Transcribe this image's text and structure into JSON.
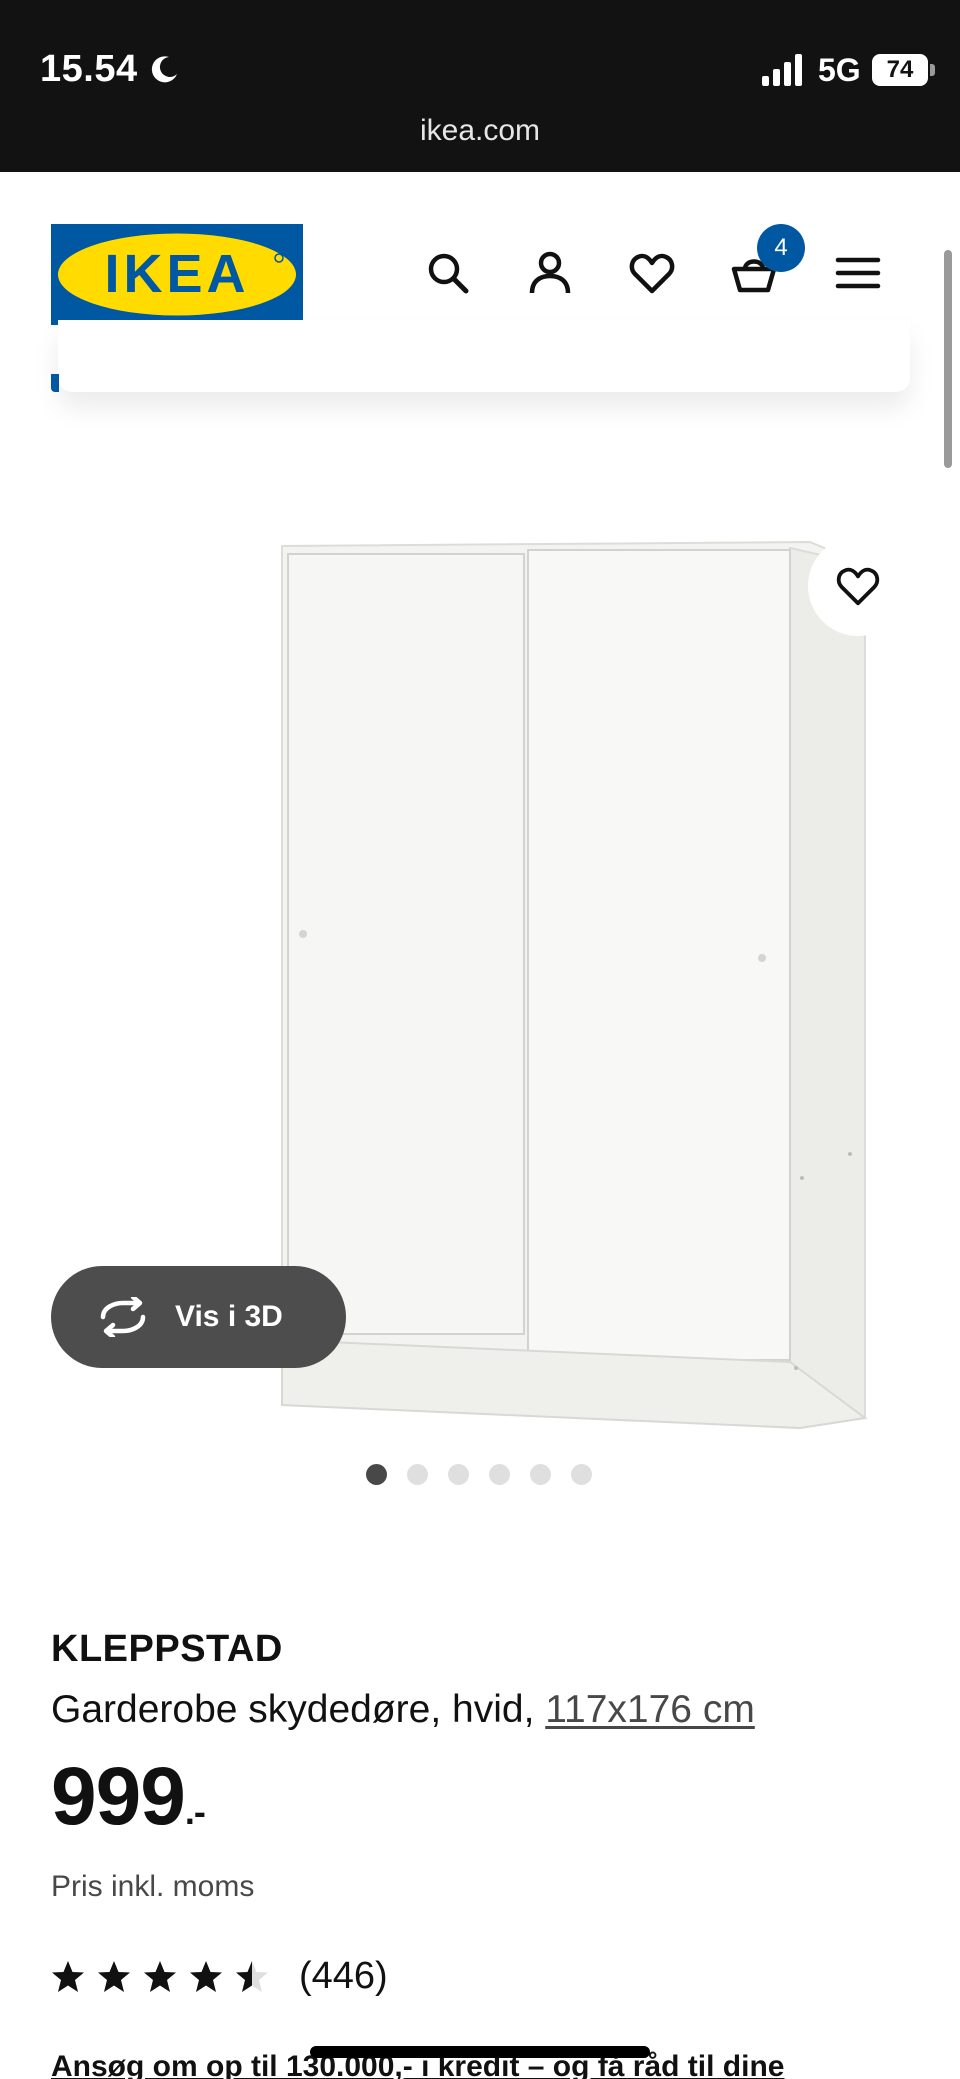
{
  "status_bar": {
    "time": "15.54",
    "network": "5G",
    "battery": "74"
  },
  "browser": {
    "url": "ikea.com"
  },
  "header": {
    "brand": "IKEA",
    "cart_count": "4"
  },
  "product_image": {
    "view3d_label": "Vis i 3D",
    "slide_count": 6,
    "active_slide": 1
  },
  "product": {
    "name": "KLEPPSTAD",
    "description": "Garderobe skydedøre, hvid, ",
    "size": "117x176 cm",
    "price": "999",
    "price_suffix": ".-",
    "price_note": "Pris inkl. moms",
    "rating": 4.5,
    "review_count": "(446)"
  },
  "credit_banner": {
    "text": "Ansøg om op til 130.000,- i kredit – og få råd til dine"
  },
  "colors": {
    "brand_blue": "#0058a3",
    "brand_yellow": "#ffdb00",
    "topbar": "#121212",
    "button_dark": "#4d4d4d"
  }
}
